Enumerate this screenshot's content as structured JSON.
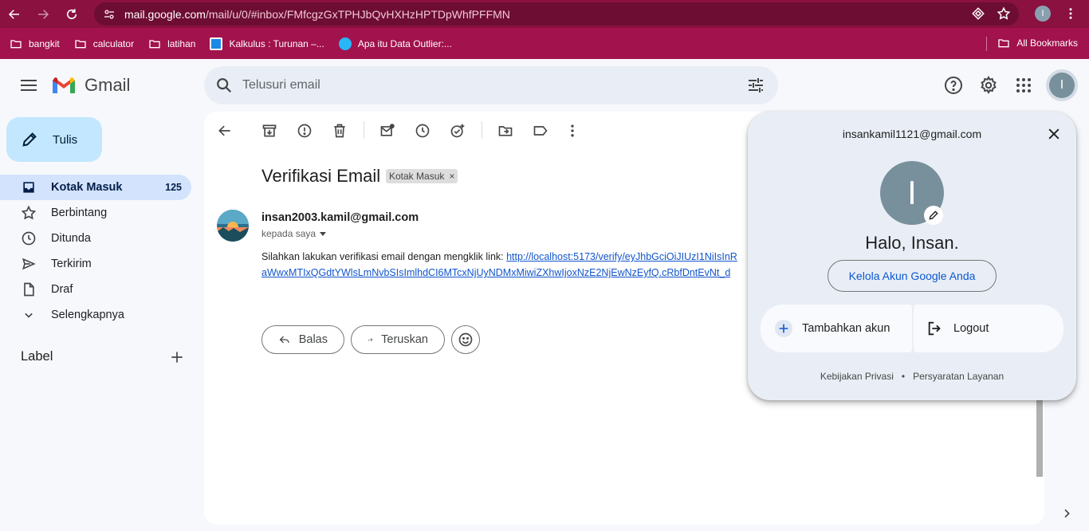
{
  "browser": {
    "url_host": "mail.google.com",
    "url_path": "/mail/u/0/#inbox/FMfcgzGxTPHJbQvHXHzHPTDpWhfPFFMN",
    "profile_initial": "I",
    "bookmarks": [
      {
        "label": "bangkit",
        "icon": "folder-icon"
      },
      {
        "label": "calculator",
        "icon": "folder-icon"
      },
      {
        "label": "latihan",
        "icon": "folder-icon"
      },
      {
        "label": "Kalkulus : Turunan –...",
        "icon": "site-favicon",
        "color": "#1e88e5"
      },
      {
        "label": "Apa itu Data Outlier:...",
        "icon": "site-favicon",
        "color": "#29b6f6"
      }
    ],
    "all_bookmarks": "All Bookmarks"
  },
  "header": {
    "product": "Gmail",
    "search_placeholder": "Telusuri email",
    "avatar_initial": "I"
  },
  "sidebar": {
    "compose_label": "Tulis",
    "items": [
      {
        "label": "Kotak Masuk",
        "count": "125",
        "icon": "inbox-icon",
        "active": true
      },
      {
        "label": "Berbintang",
        "icon": "star-icon"
      },
      {
        "label": "Ditunda",
        "icon": "clock-icon"
      },
      {
        "label": "Terkirim",
        "icon": "send-icon"
      },
      {
        "label": "Draf",
        "icon": "draft-icon"
      },
      {
        "label": "Selengkapnya",
        "icon": "chevron-down-icon"
      }
    ],
    "label_title": "Label"
  },
  "email": {
    "subject": "Verifikasi Email",
    "chip": "Kotak Masuk",
    "chip_close": "×",
    "sender": "insan2003.kamil@gmail.com",
    "to": "kepada saya",
    "body_text": "Silahkan lakukan verifikasi email dengan mengklik link: ",
    "link_line1": "http://localhost:5173/verify/eyJhbGciOiJIUzI1NiIsInR",
    "link_line2": "aWwxMTIxQGdtYWlsLmNvbSIsImlhdCI6MTcxNjUyNDMxMiwiZXhwIjoxNzE2NjEwNzEyfQ.cRbfDntEvNt_d",
    "reply_label": "Balas",
    "forward_label": "Teruskan"
  },
  "account_popup": {
    "email": "insankamil1121@gmail.com",
    "avatar_initial": "I",
    "greeting": "Halo, Insan.",
    "manage_label": "Kelola Akun Google Anda",
    "add_account": "Tambahkan akun",
    "logout": "Logout",
    "privacy": "Kebijakan Privasi",
    "dot": "•",
    "terms": "Persyaratan Layanan"
  },
  "colors": {
    "browser_bar": "#8a1140",
    "bookmarks_bar": "#a2124d",
    "compose_bg": "#c2e7ff",
    "active_nav": "#d3e3fd",
    "link": "#1155cc",
    "avatar": "#78909c"
  }
}
